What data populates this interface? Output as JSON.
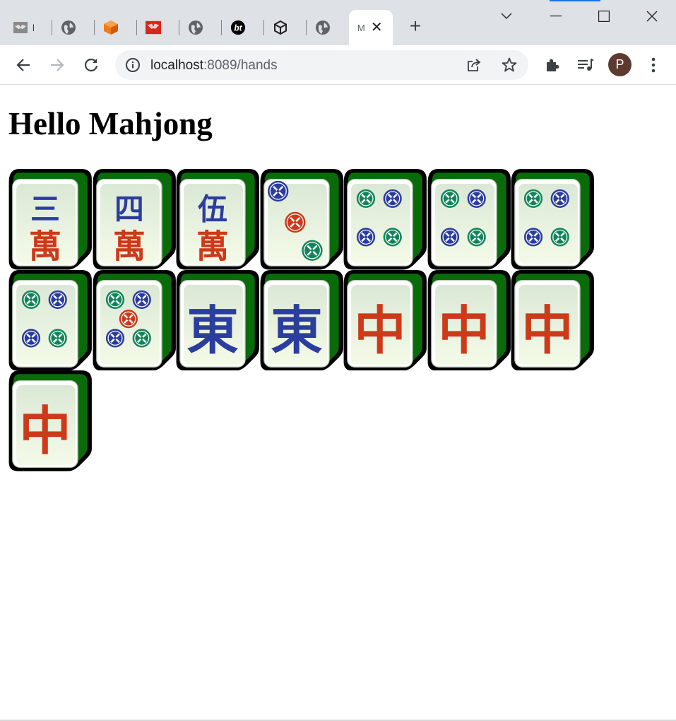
{
  "browser": {
    "tabs": [
      {
        "title": "l",
        "icon": "mahjong-tile-favicon"
      },
      {
        "title": "",
        "icon": "globe-icon"
      },
      {
        "title": "",
        "icon": "orange-box-icon"
      },
      {
        "title": "",
        "icon": "red-logo-icon"
      },
      {
        "title": "",
        "icon": "globe-icon"
      },
      {
        "title": "",
        "icon": "bt-icon"
      },
      {
        "title": "",
        "icon": "cube-icon"
      },
      {
        "title": "",
        "icon": "globe-icon"
      }
    ],
    "active_tab": {
      "title": "M",
      "close": "✕"
    },
    "new_tab": "+",
    "url_host": "localhost",
    "url_path": ":8089/hands",
    "profile_initial": "P"
  },
  "page": {
    "title": "Hello Mahjong"
  },
  "hand": {
    "tiles": [
      {
        "kind": "character",
        "num": "三",
        "suit": "萬",
        "label": "3 Characters"
      },
      {
        "kind": "character",
        "num": "四",
        "suit": "萬",
        "label": "4 Characters"
      },
      {
        "kind": "character",
        "num": "伍",
        "suit": "萬",
        "label": "5 Characters"
      },
      {
        "kind": "circle",
        "count": 3,
        "label": "3 Circles"
      },
      {
        "kind": "circle",
        "count": 4,
        "label": "4 Circles"
      },
      {
        "kind": "circle",
        "count": 4,
        "label": "4 Circles"
      },
      {
        "kind": "circle",
        "count": 4,
        "label": "4 Circles"
      },
      {
        "kind": "circle",
        "count": 4,
        "label": "4 Circles"
      },
      {
        "kind": "circle",
        "count": 5,
        "label": "5 Circles"
      },
      {
        "kind": "honor",
        "char": "東",
        "color": "#2b3d9e",
        "label": "East Wind"
      },
      {
        "kind": "honor",
        "char": "東",
        "color": "#2b3d9e",
        "label": "East Wind"
      },
      {
        "kind": "honor",
        "char": "中",
        "color": "#cc3a1a",
        "label": "Red Dragon"
      },
      {
        "kind": "honor",
        "char": "中",
        "color": "#cc3a1a",
        "label": "Red Dragon"
      },
      {
        "kind": "honor",
        "char": "中",
        "color": "#cc3a1a",
        "label": "Red Dragon"
      },
      {
        "kind": "honor",
        "char": "中",
        "color": "#cc3a1a",
        "label": "Red Dragon"
      }
    ]
  },
  "colors": {
    "tile_back": "#0a6b0a",
    "tile_outline": "#000000",
    "tile_face_top": "#dbe8d6",
    "tile_face_bottom": "#f4fae8",
    "char_blue": "#2b3d9e",
    "char_red": "#cc3a1a",
    "dot_green": "#12855a",
    "dot_blue": "#2b3d9e",
    "dot_red": "#cc3a1a"
  }
}
